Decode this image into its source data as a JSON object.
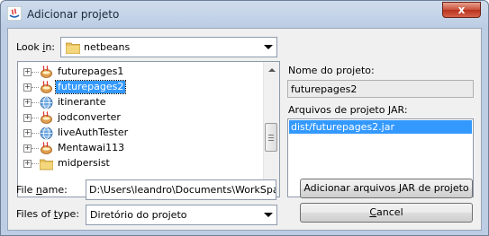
{
  "window": {
    "title": "Adicionar projeto",
    "close_glyph": "x"
  },
  "look_in": {
    "label_pre": "Look ",
    "label_key": "i",
    "label_post": "n:",
    "value": "netbeans",
    "icon": "folder-icon"
  },
  "tree": {
    "items": [
      {
        "label": "futurepages1",
        "icon": "netbeans-project-icon",
        "selected": false
      },
      {
        "label": "futurepages2",
        "icon": "netbeans-project-icon",
        "selected": true
      },
      {
        "label": "itinerante",
        "icon": "web-project-globe-icon",
        "selected": false
      },
      {
        "label": "jodconverter",
        "icon": "netbeans-project-icon",
        "selected": false
      },
      {
        "label": "liveAuthTester",
        "icon": "web-project-globe-icon",
        "selected": false
      },
      {
        "label": "Mentawai113",
        "icon": "netbeans-project-icon",
        "selected": false
      },
      {
        "label": "midpersist",
        "icon": "folder-icon",
        "selected": false
      }
    ]
  },
  "project_name": {
    "label": "Nome do projeto:",
    "value": "futurepages2"
  },
  "jar_files": {
    "label": "Arquivos de projeto JAR:",
    "items": [
      "dist/futurepages2.jar"
    ]
  },
  "file_name": {
    "label_pre": "File ",
    "label_key": "n",
    "label_post": "ame:",
    "value": "D:\\Users\\leandro\\Documents\\WorkSpaces\\"
  },
  "files_of_type": {
    "label_pre": "Files of ",
    "label_key": "t",
    "label_post": "ype:",
    "value": "Diretório do projeto"
  },
  "buttons": {
    "add_jar": "Adicionar arquivos JAR de projeto",
    "cancel_key": "C",
    "cancel_rest": "ancel"
  },
  "colors": {
    "selection": "#3399ff",
    "title_bar": "#bccde4",
    "close_button": "#c9503a"
  }
}
